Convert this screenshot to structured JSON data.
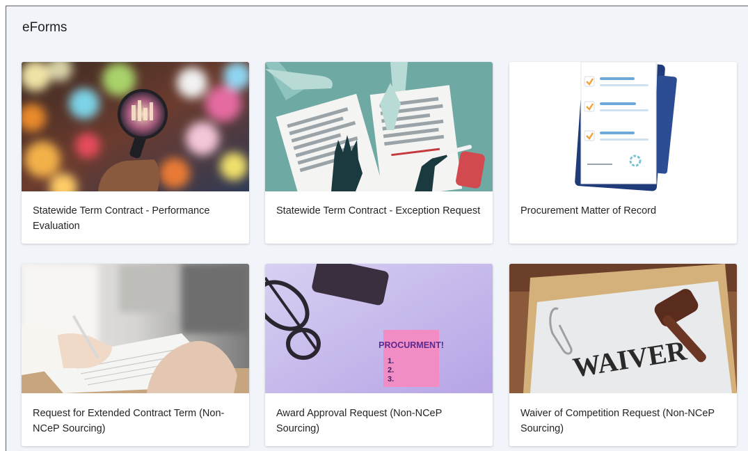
{
  "page": {
    "title": "eForms"
  },
  "forms": [
    {
      "title": "Statewide Term Contract - Performance Evaluation",
      "image": "bokeh-city-magnifier-image"
    },
    {
      "title": "Statewide Term Contract - Exception Request",
      "image": "hands-signing-documents-image"
    },
    {
      "title": "Procurement Matter of Record",
      "image": "clipboard-checklist-image"
    },
    {
      "title": "Request for Extended Contract Term (Non-NCeP Sourcing)",
      "image": "hand-signing-paper-image"
    },
    {
      "title": "Award Approval Request (Non-NCeP Sourcing)",
      "image": "procurement-sticky-note-image"
    },
    {
      "title": "Waiver of Competition Request (Non-NCeP Sourcing)",
      "image": "waiver-gavel-image"
    }
  ],
  "images": {
    "procurement_note": {
      "heading": "PROCURMENT!",
      "items": [
        "1.",
        "2.",
        "3."
      ]
    },
    "waiver_doc": {
      "text": "WAIVER"
    }
  },
  "colors": {
    "page_background": "#f1f5f9",
    "card_background": "#ffffff",
    "teal_scene": "#6fa9a3",
    "navy_clipboard": "#1f3b7a",
    "check_orange": "#f2a33a",
    "sticky_pink": "#f28cc4",
    "lavender_desk": "#c7b8ec",
    "folder_tan": "#d4b17a"
  }
}
